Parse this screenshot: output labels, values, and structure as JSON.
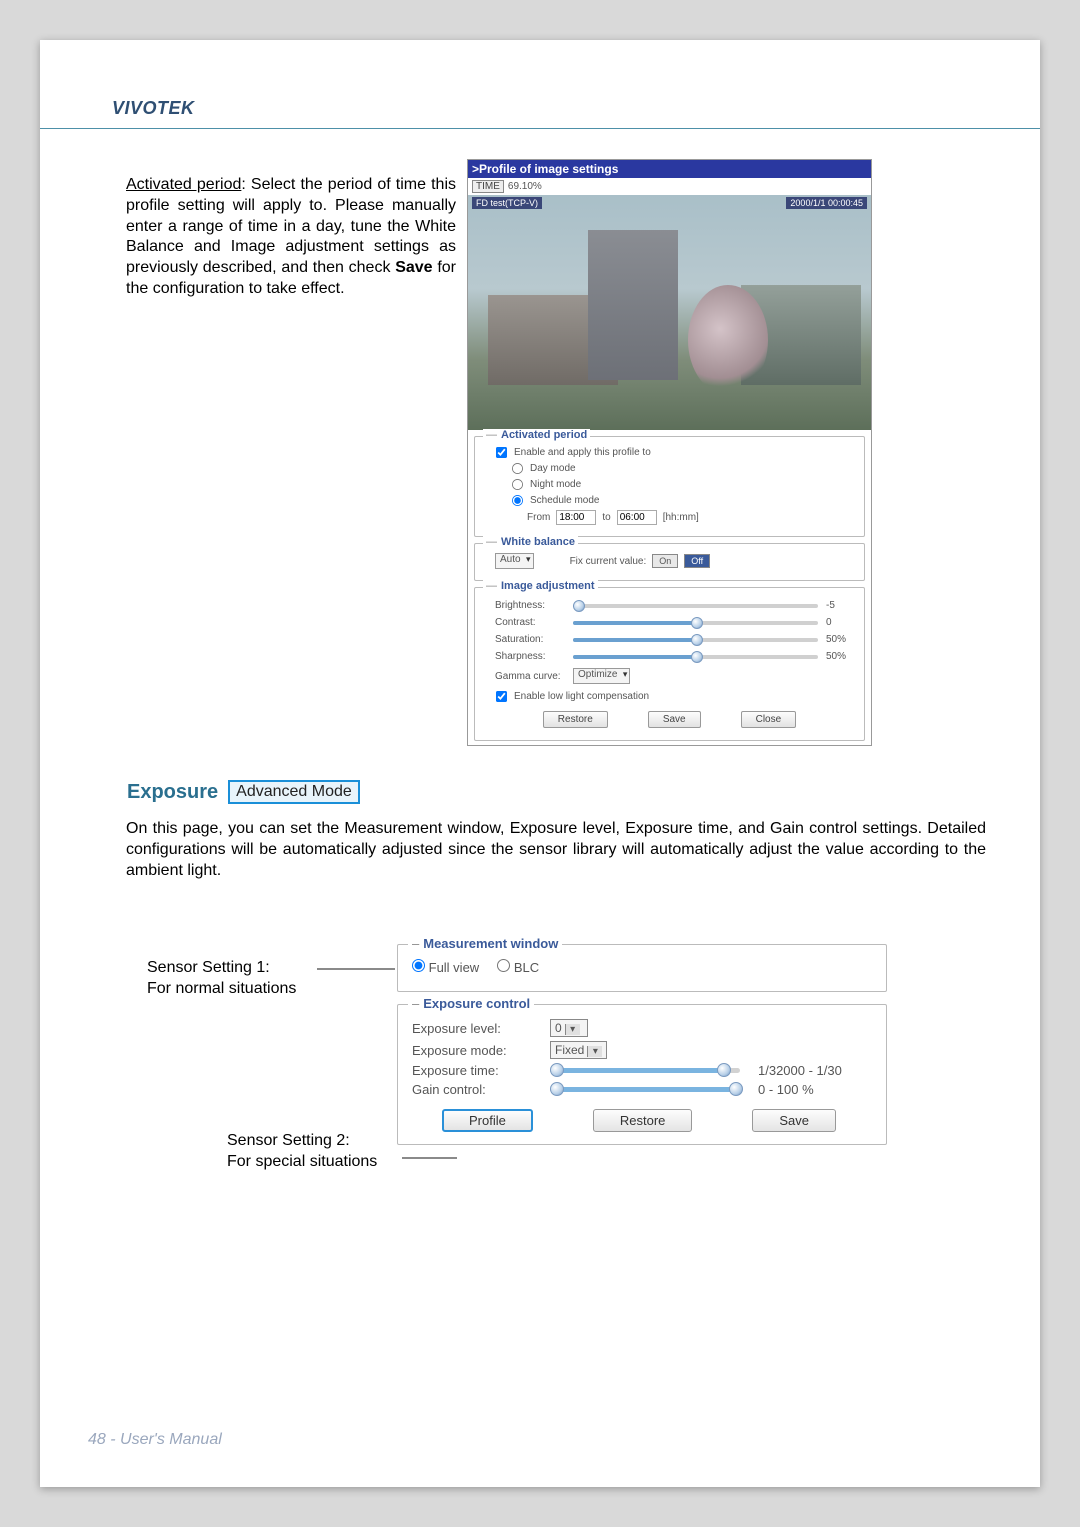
{
  "brand": "VIVOTEK",
  "intro": {
    "label": "Activated period",
    "text_after": ": Select the period of time this profile setting will apply to. Please manually enter a range of time in a day, tune the White Balance and Image adjustment settings as previously described, and then check ",
    "save_word": "Save",
    "tail": " for the configuration to take effect."
  },
  "profile": {
    "title": ">Profile of image settings",
    "time_btn": "TIME",
    "time_pct": "69.10%",
    "cam_label": "FD test(TCP-V)",
    "cam_time": "2000/1/1 00:00:45",
    "activated": {
      "legend": "Activated period",
      "enable_label": "Enable and apply this profile to",
      "day": "Day mode",
      "night": "Night mode",
      "schedule": "Schedule mode",
      "from_lbl": "From",
      "from_val": "18:00",
      "to_lbl": "to",
      "to_val": "06:00",
      "fmt": "[hh:mm]"
    },
    "wb": {
      "legend": "White balance",
      "mode": "Auto",
      "fix_lbl": "Fix current value:",
      "on": "On",
      "off": "Off"
    },
    "img": {
      "legend": "Image adjustment",
      "brightness": {
        "label": "Brightness:",
        "value": "-5"
      },
      "contrast": {
        "label": "Contrast:",
        "value": "0"
      },
      "saturation": {
        "label": "Saturation:",
        "value": "50%"
      },
      "sharpness": {
        "label": "Sharpness:",
        "value": "50%"
      },
      "gamma_lbl": "Gamma curve:",
      "gamma_val": "Optimize",
      "llc": "Enable low light compensation"
    },
    "buttons": {
      "restore": "Restore",
      "save": "Save",
      "close": "Close"
    }
  },
  "exposure": {
    "heading": "Exposure",
    "badge": "Advanced Mode",
    "para": "On this page, you can set the Measurement window, Exposure level, Exposure time, and Gain control settings. Detailed configurations will be automatically adjusted since the sensor library will automatically adjust the value according to the ambient light."
  },
  "sensor": {
    "s1a": "Sensor Setting 1:",
    "s1b": "For normal situations",
    "s2a": "Sensor Setting 2:",
    "s2b": "For special situations",
    "meas": {
      "legend": "Measurement window",
      "full": "Full view",
      "blc": "BLC"
    },
    "ctrl": {
      "legend": "Exposure control",
      "level_lbl": "Exposure level:",
      "level_val": "0",
      "mode_lbl": "Exposure mode:",
      "mode_val": "Fixed",
      "time_lbl": "Exposure time:",
      "time_val": "1/32000 - 1/30",
      "gain_lbl": "Gain control:",
      "gain_val": "0 - 100 %"
    },
    "buttons": {
      "profile": "Profile",
      "restore": "Restore",
      "save": "Save"
    }
  },
  "footer": "48 - User's Manual"
}
